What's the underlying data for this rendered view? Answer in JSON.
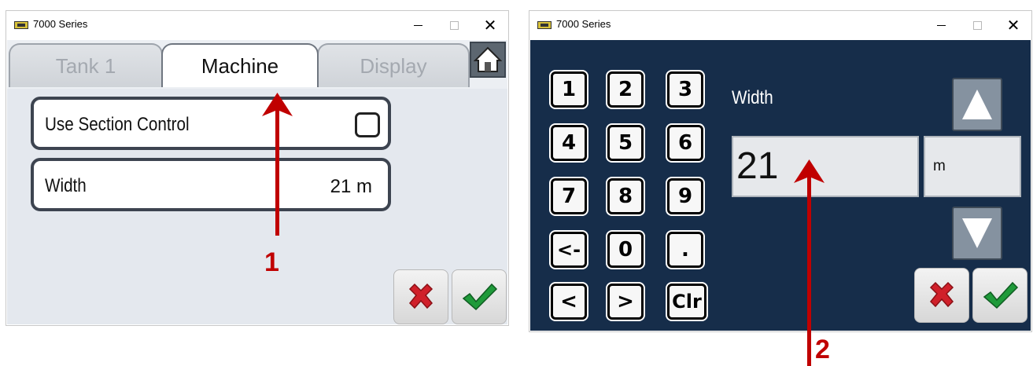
{
  "window_left": {
    "title": "7000 Series",
    "tabs": [
      {
        "label": "Tank 1",
        "active": false
      },
      {
        "label": "Machine",
        "active": true
      },
      {
        "label": "Display",
        "active": false
      }
    ],
    "rows": [
      {
        "label": "Use Section Control",
        "checked": false
      },
      {
        "label": "Width",
        "value": "21 m"
      }
    ]
  },
  "window_right": {
    "title": "7000 Series",
    "keypad": [
      "1",
      "2",
      "3",
      "4",
      "5",
      "6",
      "7",
      "8",
      "9",
      "<-",
      "0",
      ".",
      "<",
      ">",
      "Clr"
    ],
    "field_label": "Width",
    "field_value": "21",
    "unit": "m"
  },
  "annotations": [
    "1",
    "2"
  ],
  "colors": {
    "annotation": "#c00000",
    "keypad_bg": "#162d4a",
    "confirm": "#1f9a3a",
    "cancel": "#d0202a"
  },
  "icons": {
    "home": "home-icon",
    "cancel": "red-x-icon",
    "confirm": "green-check-icon",
    "up": "up-arrow-icon",
    "down": "down-arrow-icon"
  }
}
